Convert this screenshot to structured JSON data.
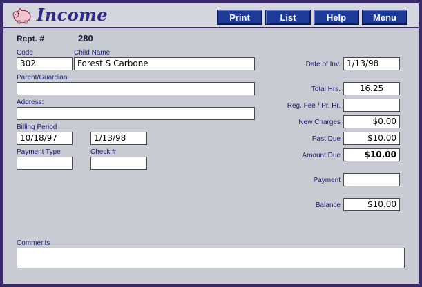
{
  "header": {
    "title": "Income",
    "nav": [
      "Print",
      "List",
      "Help",
      "Menu"
    ]
  },
  "receipt": {
    "label": "Rcpt. #",
    "value": "280"
  },
  "form": {
    "code": {
      "label": "Code",
      "value": "302"
    },
    "child_name": {
      "label": "Child Name",
      "value": "Forest S Carbone"
    },
    "parent": {
      "label": "Parent/Guardian",
      "value": ""
    },
    "address": {
      "label": "Address:",
      "value": ""
    },
    "billing": {
      "label": "Billing Period",
      "start": "10/18/97",
      "end": "1/13/98"
    },
    "payment_type": {
      "label": "Payment Type",
      "value": ""
    },
    "check": {
      "label": "Check #",
      "value": ""
    },
    "comments": {
      "label": "Comments",
      "value": ""
    }
  },
  "summary": {
    "date_of_inv": {
      "label": "Date of Inv.",
      "value": "1/13/98"
    },
    "total_hrs": {
      "label": "Total Hrs.",
      "value": "16.25"
    },
    "reg_fee": {
      "label": "Reg. Fee / Pr. Hr.",
      "value": ""
    },
    "new_charges": {
      "label": "New Charges",
      "value": "$0.00"
    },
    "past_due": {
      "label": "Past Due",
      "value": "$10.00"
    },
    "amount_due": {
      "label": "Amount Due",
      "value": "$10.00"
    },
    "payment": {
      "label": "Payment",
      "value": ""
    },
    "balance": {
      "label": "Balance",
      "value": "$10.00"
    }
  },
  "colors": {
    "frame": "#3b2a6a",
    "panel": "#c9cbd3",
    "nav_button": "#1e3a99",
    "title": "#2d2a8a",
    "label": "#1c1c70"
  },
  "icons": {
    "logo": "piggy-bank-icon"
  }
}
